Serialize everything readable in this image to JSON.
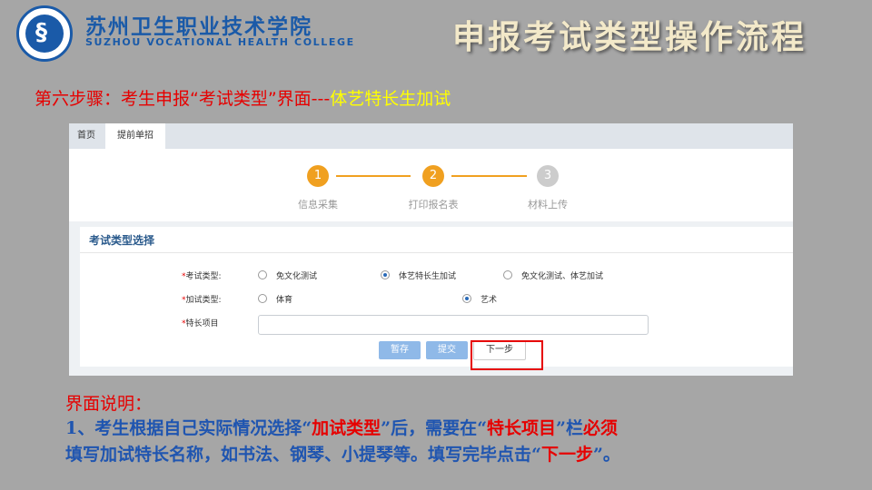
{
  "header": {
    "college_cn": "苏州卫生职业技术学院",
    "college_en": "SUZHOU VOCATIONAL HEALTH COLLEGE",
    "title": "申报考试类型操作流程"
  },
  "step_heading": {
    "main": "第六步骤：考生申报“考试类型”界面---",
    "highlight": "体艺特长生加试"
  },
  "app": {
    "tabs": [
      {
        "label": "首页"
      },
      {
        "label": "提前单招"
      }
    ],
    "steps": [
      {
        "num": "1",
        "label": "信息采集",
        "status": "done"
      },
      {
        "num": "2",
        "label": "打印报名表",
        "status": "done"
      },
      {
        "num": "3",
        "label": "材料上传",
        "status": "pending"
      }
    ],
    "section_title": "考试类型选择",
    "form": {
      "exam_type_label": "考试类型:",
      "exam_options": [
        {
          "label": "免文化测试",
          "selected": false
        },
        {
          "label": "体艺特长生加试",
          "selected": true
        },
        {
          "label": "免文化测试、体艺加试",
          "selected": false
        }
      ],
      "extra_type_label": "加试类型:",
      "extra_options": [
        {
          "label": "体育",
          "selected": false
        },
        {
          "label": "艺术",
          "selected": true
        }
      ],
      "specialty_label": "特长项目",
      "specialty_value": "",
      "required_mark": "*"
    },
    "buttons": {
      "save": "暂存",
      "submit": "提交",
      "next": "下一步"
    }
  },
  "explanation": {
    "title": "界面说明：",
    "p1": "1、考生根据自己实际情况选择“",
    "p1_red": "加试类型",
    "p2": "”后，需要在“",
    "p2_red": "特长项目",
    "p3": "”栏",
    "p3_red": "必须",
    "p4": "填写加试特长名称，如书法、钢琴、小提琴等。填写完毕点击“",
    "p4_red": "下一步",
    "p5": "”。"
  },
  "colors": {
    "accent_blue": "#1a5aa8",
    "step_orange": "#f0a020",
    "red": "#e60000"
  }
}
